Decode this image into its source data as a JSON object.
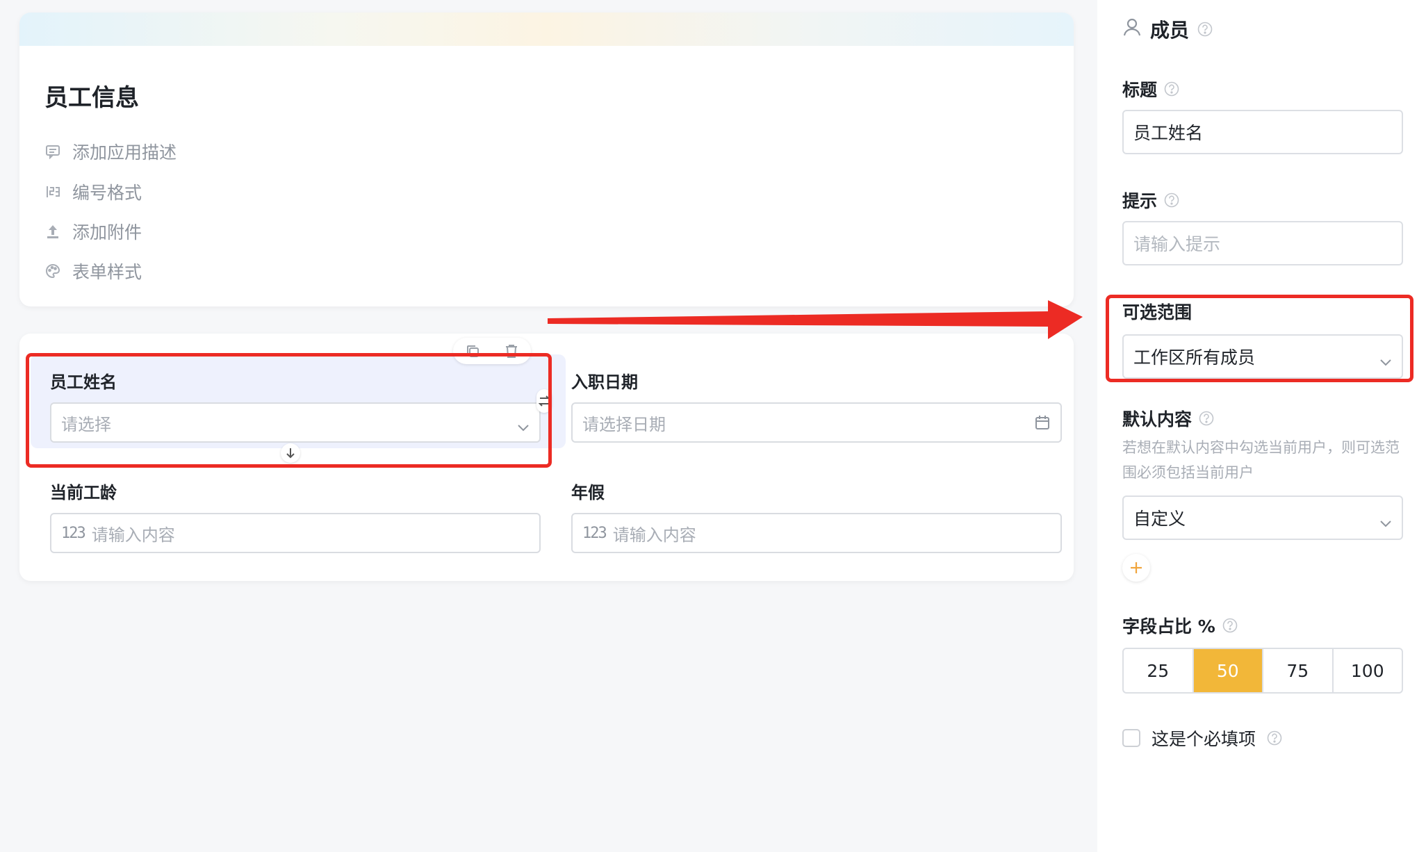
{
  "form": {
    "title": "员工信息",
    "menu": [
      {
        "label": "添加应用描述",
        "icon": "comment-icon"
      },
      {
        "label": "编号格式",
        "icon": "number-format-icon"
      },
      {
        "label": "添加附件",
        "icon": "upload-icon"
      },
      {
        "label": "表单样式",
        "icon": "palette-icon"
      }
    ]
  },
  "fields": {
    "employee_name": {
      "label": "员工姓名",
      "placeholder": "请选择"
    },
    "join_date": {
      "label": "入职日期",
      "placeholder": "请选择日期"
    },
    "seniority": {
      "label": "当前工龄",
      "placeholder": "请输入内容",
      "prefix": "123"
    },
    "annual_leave": {
      "label": "年假",
      "placeholder": "请输入内容",
      "prefix": "123"
    }
  },
  "panel": {
    "title": "成员",
    "title_label": "标题",
    "title_value": "员工姓名",
    "hint_label": "提示",
    "hint_placeholder": "请输入提示",
    "range_label": "可选范围",
    "range_value": "工作区所有成员",
    "default_label": "默认内容",
    "default_hint": "若想在默认内容中勾选当前用户，则可选范围必须包括当前用户",
    "default_value": "自定义",
    "width_label": "字段占比 %",
    "width_options": [
      "25",
      "50",
      "75",
      "100"
    ],
    "width_selected": "50",
    "required_label": "这是个必填项"
  },
  "colors": {
    "accent": "#f2b739",
    "annotation_red": "#ec2b24",
    "selected_field_bg": "#eef1fd"
  }
}
